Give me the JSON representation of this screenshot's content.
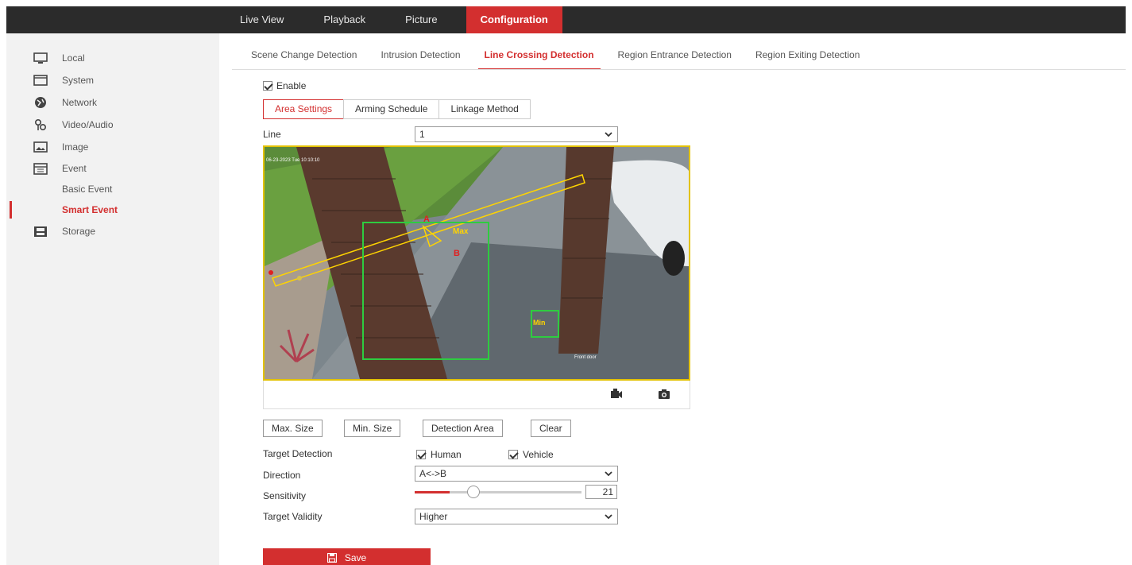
{
  "top_nav": [
    "Live View",
    "Playback",
    "Picture",
    "Configuration"
  ],
  "top_nav_active": "Configuration",
  "sidebar": {
    "items": [
      {
        "label": "Local",
        "icon": "monitor-icon"
      },
      {
        "label": "System",
        "icon": "system-icon"
      },
      {
        "label": "Network",
        "icon": "globe-icon"
      },
      {
        "label": "Video/Audio",
        "icon": "video-audio-icon"
      },
      {
        "label": "Image",
        "icon": "image-icon"
      },
      {
        "label": "Event",
        "icon": "calendar-icon"
      }
    ],
    "subitems": [
      "Basic Event",
      "Smart Event"
    ],
    "active_subitem": "Smart Event",
    "storage": {
      "label": "Storage",
      "icon": "storage-icon"
    }
  },
  "subtabs": [
    "Scene Change Detection",
    "Intrusion Detection",
    "Line Crossing Detection",
    "Region Entrance Detection",
    "Region Exiting Detection"
  ],
  "subtab_active": "Line Crossing Detection",
  "enable_label": "Enable",
  "steps": [
    "Area Settings",
    "Arming Schedule",
    "Linkage Method"
  ],
  "step_active": "Area Settings",
  "line_label": "Line",
  "line_value": "1",
  "video": {
    "osd_text": "06-23-2023 Tue 10:10:10",
    "label_a": "A",
    "label_b": "B",
    "label_max": "Max",
    "label_min": "Min",
    "osd_bottom": "Front door"
  },
  "buttons": [
    "Max. Size",
    "Min. Size",
    "Detection Area",
    "Clear"
  ],
  "target_detection_label": "Target Detection",
  "human_label": "Human",
  "vehicle_label": "Vehicle",
  "direction_label": "Direction",
  "direction_value": "A<->B",
  "sensitivity_label": "Sensitivity",
  "sensitivity_value": "21",
  "sensitivity_fraction": 0.21,
  "target_validity_label": "Target Validity",
  "target_validity_value": "Higher",
  "save_label": "Save",
  "colors": {
    "accent": "#d32f2f",
    "topbar": "#2b2b2b",
    "sidebar": "#f2f2f2",
    "detect_line": "#e3c200",
    "detect_box": "#2ecc40"
  }
}
